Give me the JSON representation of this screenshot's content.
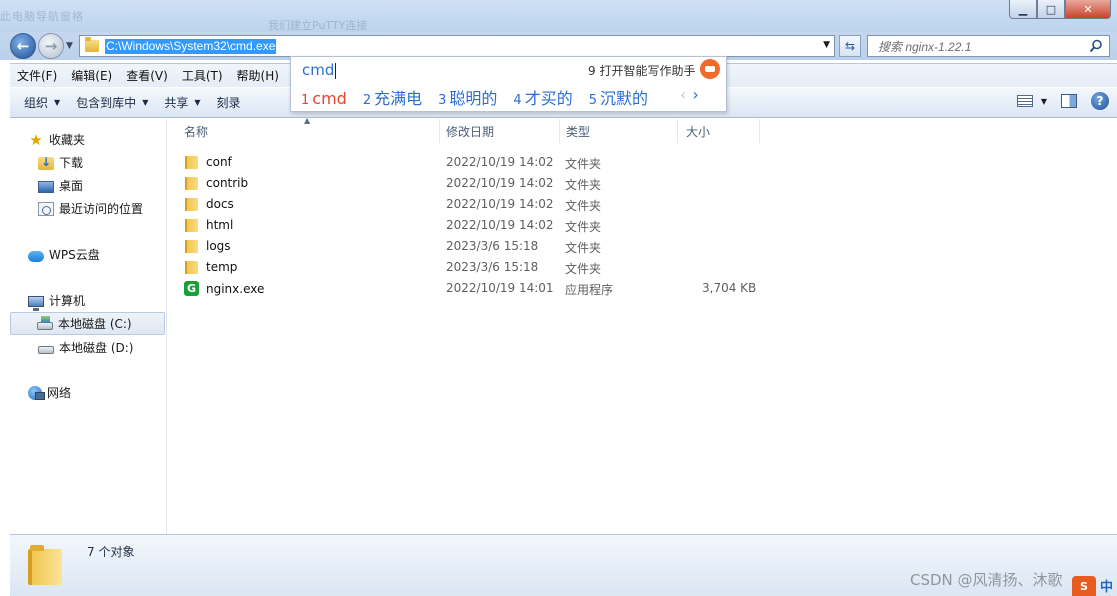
{
  "titlebar": {
    "ghost_left": "此电脑导航窗格",
    "ghost_center": "我们建立PuTTY连接"
  },
  "window_controls": {
    "minimize": "▁",
    "maximize": "□",
    "close": "✕"
  },
  "address": {
    "path": "C:\\Windows\\System32\\cmd.exe"
  },
  "search": {
    "placeholder": "搜索 nginx-1.22.1"
  },
  "menu": [
    "文件(F)",
    "编辑(E)",
    "查看(V)",
    "工具(T)",
    "帮助(H)"
  ],
  "toolbar": {
    "organize": "组织",
    "include_library": "包含到库中",
    "share": "共享",
    "burn": "刻录"
  },
  "ime": {
    "input": "cmd",
    "assistant": "9 打开智能写作助手",
    "candidates": [
      {
        "num": "1",
        "text": "cmd"
      },
      {
        "num": "2",
        "text": "充满电"
      },
      {
        "num": "3",
        "text": "聪明的"
      },
      {
        "num": "4",
        "text": "才买的"
      },
      {
        "num": "5",
        "text": "沉默的"
      }
    ],
    "prev": "‹",
    "next": "›"
  },
  "sidebar": {
    "favorites": "收藏夹",
    "downloads": "下载",
    "desktop": "桌面",
    "recent": "最近访问的位置",
    "wps": "WPS云盘",
    "computer": "计算机",
    "drive_c": "本地磁盘 (C:)",
    "drive_d": "本地磁盘 (D:)",
    "network": "网络"
  },
  "columns": {
    "name": "名称",
    "date": "修改日期",
    "type": "类型",
    "size": "大小"
  },
  "files": [
    {
      "name": "conf",
      "date": "2022/10/19 14:02",
      "type": "文件夹",
      "size": ""
    },
    {
      "name": "contrib",
      "date": "2022/10/19 14:02",
      "type": "文件夹",
      "size": ""
    },
    {
      "name": "docs",
      "date": "2022/10/19 14:02",
      "type": "文件夹",
      "size": ""
    },
    {
      "name": "html",
      "date": "2022/10/19 14:02",
      "type": "文件夹",
      "size": ""
    },
    {
      "name": "logs",
      "date": "2023/3/6 15:18",
      "type": "文件夹",
      "size": ""
    },
    {
      "name": "temp",
      "date": "2023/3/6 15:18",
      "type": "文件夹",
      "size": ""
    },
    {
      "name": "nginx.exe",
      "date": "2022/10/19 14:01",
      "type": "应用程序",
      "size": "3,704 KB"
    }
  ],
  "details": {
    "count": "7 个对象"
  },
  "watermark": {
    "text": "CSDN @风清扬、沐歌",
    "logo": "S",
    "zh": "中"
  }
}
